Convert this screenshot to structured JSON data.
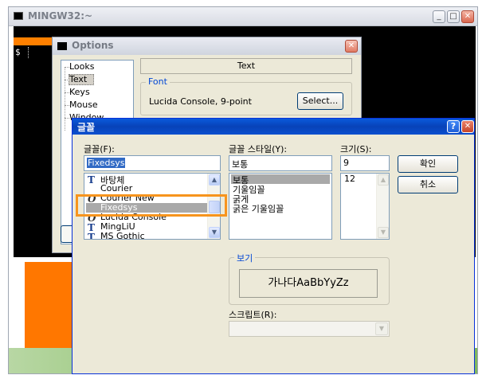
{
  "outer_window": {
    "title": "MINGW32:~",
    "prompt": "$",
    "buttons": {
      "minimize": "_",
      "maximize": "□",
      "close": "✕"
    }
  },
  "options_window": {
    "title": "Options",
    "close": "✕",
    "tree_items": [
      "Looks",
      "Text",
      "Keys",
      "Mouse",
      "Window"
    ],
    "selected_tree_item": "Text",
    "section_header": "Text",
    "font_group_label": "Font",
    "font_value": "Lucida Console, 9-point",
    "select_button": "Select..."
  },
  "font_dialog": {
    "title": "글꼴",
    "help": "?",
    "close": "✕",
    "font_label": "글꼴(F):",
    "font_value": "Fixedsys",
    "font_list": [
      {
        "name": "바탕체",
        "icon": "truetype-icon"
      },
      {
        "name": "Courier",
        "icon": ""
      },
      {
        "name": "Courier New",
        "icon": "opentype-icon"
      },
      {
        "name": "Fixedsys",
        "icon": "",
        "selected": true
      },
      {
        "name": "Lucida Console",
        "icon": "opentype-icon"
      },
      {
        "name": "MingLiU",
        "icon": "truetype-icon"
      },
      {
        "name": "MS Gothic",
        "icon": "truetype-icon"
      }
    ],
    "style_label": "글꼴 스타일(Y):",
    "style_value": "보통",
    "style_list": [
      "보통",
      "기울임꼴",
      "굵게",
      "굵은 기울임꼴"
    ],
    "size_label": "크기(S):",
    "size_value": "9",
    "size_list": [
      "12"
    ],
    "ok_button": "확인",
    "cancel_button": "취소",
    "preview_label": "보기",
    "preview_text": "가나다AaBbYyZz",
    "script_label": "스크립트(R):",
    "script_value": ""
  },
  "colors": {
    "highlight": "#f7941d",
    "terminal_bg": "#000000",
    "accent_orange": "#ff7700",
    "active_title": "#0a4fcf"
  }
}
